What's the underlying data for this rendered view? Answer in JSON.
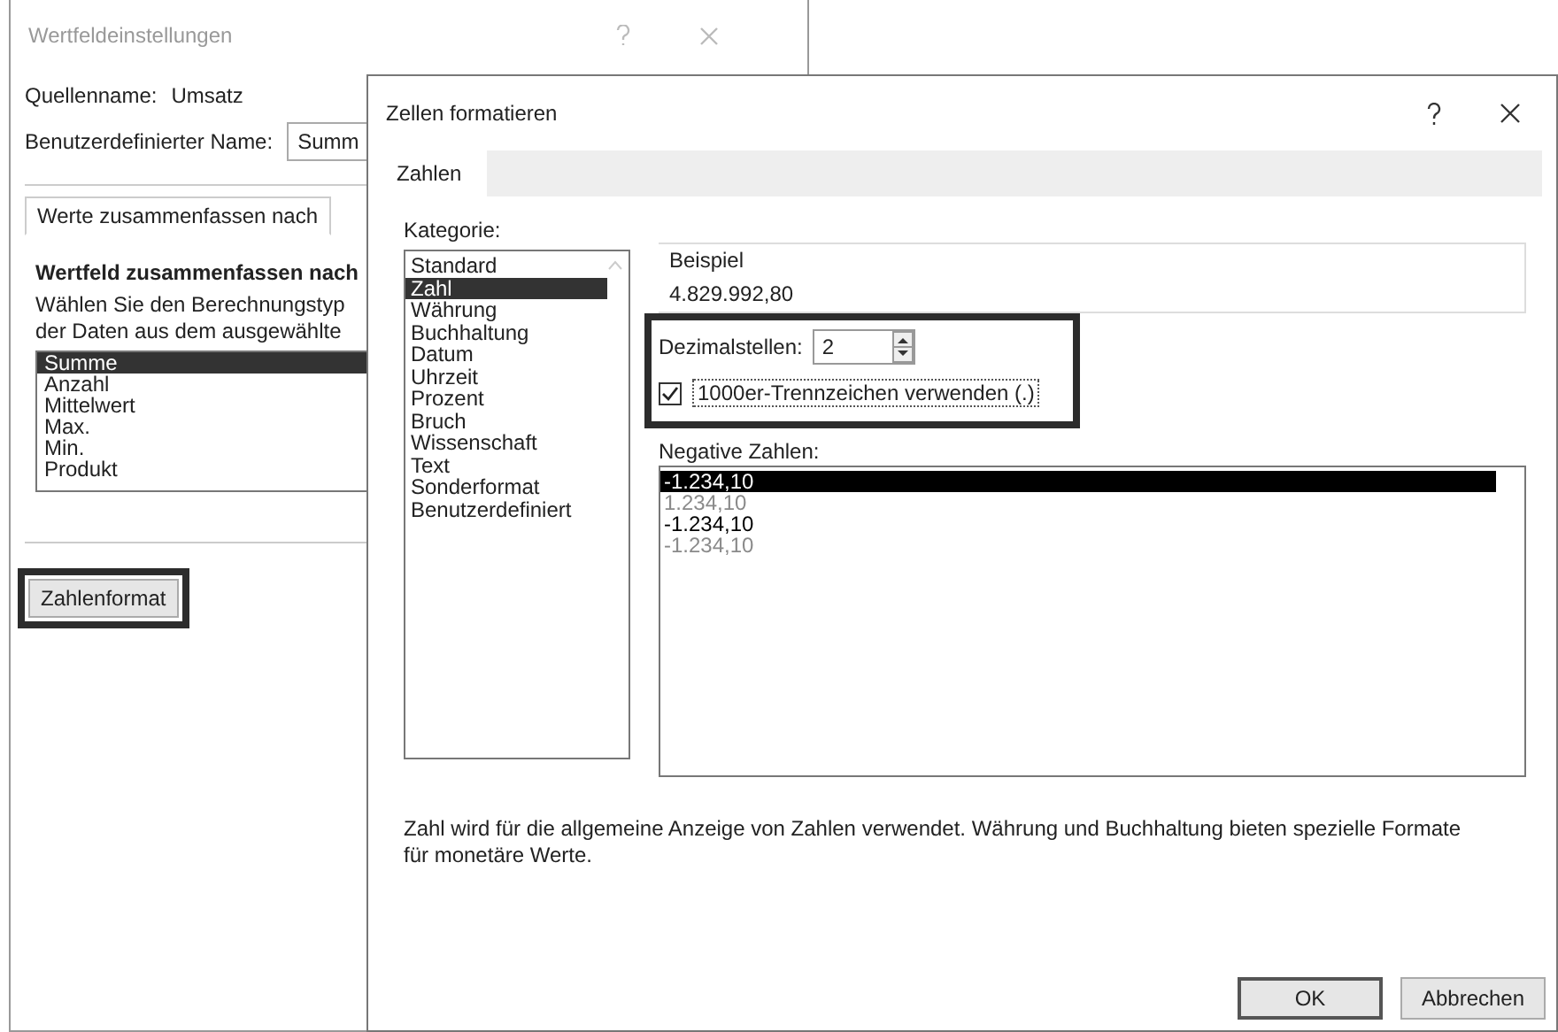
{
  "back_window": {
    "title": "Wertfeldeinstellungen",
    "source_label": "Quellenname:",
    "source_value": "Umsatz",
    "custom_name_label": "Benutzerdefinierter Name:",
    "custom_name_value": "Summ",
    "tabs": [
      {
        "label": "Werte zusammenfassen nach",
        "selected": true
      }
    ],
    "section_title": "Wertfeld zusammenfassen nach",
    "description_lines": [
      "Wählen Sie den Berechnungstyp",
      "der Daten aus dem ausgewählte"
    ],
    "functions": [
      {
        "label": "Summe",
        "selected": true
      },
      {
        "label": "Anzahl",
        "selected": false
      },
      {
        "label": "Mittelwert",
        "selected": false
      },
      {
        "label": "Max.",
        "selected": false
      },
      {
        "label": "Min.",
        "selected": false
      },
      {
        "label": "Produkt",
        "selected": false
      }
    ],
    "number_format_button": "Zahlenformat"
  },
  "dialog": {
    "title": "Zellen formatieren",
    "tabs": [
      {
        "label": "Zahlen",
        "selected": true
      }
    ],
    "category_label": "Kategorie:",
    "categories": [
      {
        "label": "Standard",
        "selected": false
      },
      {
        "label": "Zahl",
        "selected": true
      },
      {
        "label": "Währung",
        "selected": false
      },
      {
        "label": "Buchhaltung",
        "selected": false
      },
      {
        "label": "Datum",
        "selected": false
      },
      {
        "label": "Uhrzeit",
        "selected": false
      },
      {
        "label": "Prozent",
        "selected": false
      },
      {
        "label": "Bruch",
        "selected": false
      },
      {
        "label": "Wissenschaft",
        "selected": false
      },
      {
        "label": "Text",
        "selected": false
      },
      {
        "label": "Sonderformat",
        "selected": false
      },
      {
        "label": "Benutzerdefiniert",
        "selected": false
      }
    ],
    "sample_label": "Beispiel",
    "sample_value": "4.829.992,80",
    "decimals_label": "Dezimalstellen:",
    "decimals_value": "2",
    "thousands_separator": {
      "label": "1000er-Trennzeichen verwenden (.)",
      "checked": true
    },
    "negative_label": "Negative Zahlen:",
    "negative_numbers": [
      {
        "label": "-1.234,10",
        "selected": true,
        "color": "#000000"
      },
      {
        "label": "1.234,10",
        "selected": false,
        "color": "#8a8a8a"
      },
      {
        "label": "-1.234,10",
        "selected": false,
        "color": "#000000"
      },
      {
        "label": "-1.234,10",
        "selected": false,
        "color": "#8a8a8a"
      }
    ],
    "description": "Zahl wird für die allgemeine Anzeige von Zahlen verwendet. Währung und Buchhaltung bieten spezielle Formate für monetäre Werte.",
    "buttons": [
      {
        "label": "OK",
        "default": true
      },
      {
        "label": "Abbrechen",
        "default": false
      }
    ]
  }
}
